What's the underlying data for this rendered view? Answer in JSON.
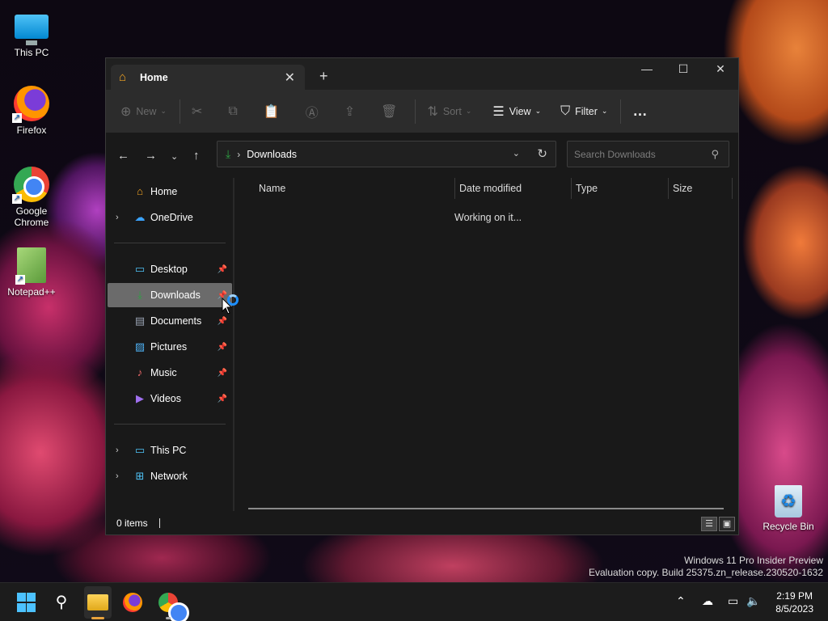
{
  "desktop": {
    "icons": [
      {
        "label": "This PC"
      },
      {
        "label": "Firefox"
      },
      {
        "label": "Google Chrome"
      },
      {
        "label": "Notepad++"
      },
      {
        "label": "Recycle Bin"
      }
    ],
    "watermark_line1": "Windows 11 Pro Insider Preview",
    "watermark_line2": "Evaluation copy. Build 25375.zn_release.230520-1632"
  },
  "window": {
    "tab_label": "Home",
    "toolbar": {
      "new_label": "New",
      "sort_label": "Sort",
      "view_label": "View",
      "filter_label": "Filter",
      "more_label": "…"
    },
    "address": {
      "crumb": "Downloads",
      "search_placeholder": "Search Downloads"
    },
    "sidebar": {
      "items": [
        {
          "label": "Home",
          "icon": "home-icon"
        },
        {
          "label": "OneDrive",
          "icon": "cloud-icon"
        },
        {
          "label": "Desktop",
          "icon": "desktop-icon"
        },
        {
          "label": "Downloads",
          "icon": "download-icon"
        },
        {
          "label": "Documents",
          "icon": "document-icon"
        },
        {
          "label": "Pictures",
          "icon": "picture-icon"
        },
        {
          "label": "Music",
          "icon": "music-icon"
        },
        {
          "label": "Videos",
          "icon": "video-icon"
        },
        {
          "label": "This PC",
          "icon": "pc-icon"
        },
        {
          "label": "Network",
          "icon": "network-icon"
        }
      ]
    },
    "columns": {
      "name": "Name",
      "date": "Date modified",
      "type": "Type",
      "size": "Size"
    },
    "loading_text": "Working on it...",
    "status_items": "0 items"
  },
  "taskbar": {
    "time": "2:19 PM",
    "date": "8/5/2023"
  },
  "colors": {
    "accent": "#4cc2ff",
    "selected_nav": "#6b6b6b",
    "window_bg": "#191919",
    "toolbar_bg": "#2c2c2c"
  }
}
